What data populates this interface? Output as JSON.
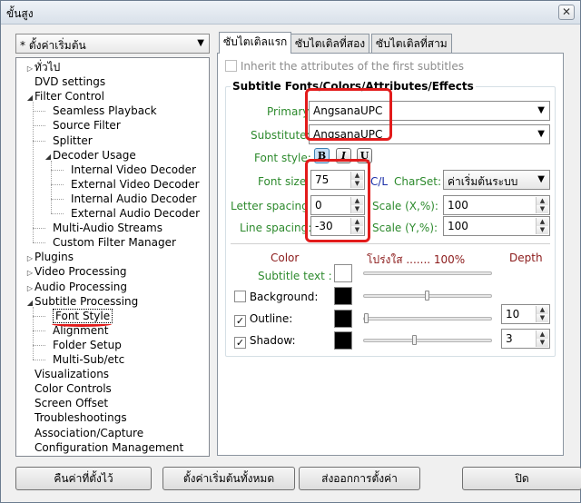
{
  "window": {
    "title": "ขั้นสูง",
    "close_glyph": "✕"
  },
  "profile": {
    "value": "* ตั้งค่าเริ่มต้น"
  },
  "tree": [
    {
      "label": "ทั่วไป",
      "level": 0,
      "exp": "▷"
    },
    {
      "label": "DVD settings",
      "level": 0,
      "exp": ""
    },
    {
      "label": "Filter Control",
      "level": 0,
      "exp": "◢"
    },
    {
      "label": "Seamless Playback",
      "level": 1,
      "exp": ""
    },
    {
      "label": "Source Filter",
      "level": 1,
      "exp": ""
    },
    {
      "label": "Splitter",
      "level": 1,
      "exp": ""
    },
    {
      "label": "Decoder Usage",
      "level": 1,
      "exp": "◢"
    },
    {
      "label": "Internal Video Decoder",
      "level": 2,
      "exp": ""
    },
    {
      "label": "External Video Decoder",
      "level": 2,
      "exp": ""
    },
    {
      "label": "Internal Audio Decoder",
      "level": 2,
      "exp": ""
    },
    {
      "label": "External Audio Decoder",
      "level": 2,
      "exp": ""
    },
    {
      "label": "Multi-Audio Streams",
      "level": 1,
      "exp": ""
    },
    {
      "label": "Custom Filter Manager",
      "level": 1,
      "exp": ""
    },
    {
      "label": "Plugins",
      "level": 0,
      "exp": "▷"
    },
    {
      "label": "Video Processing",
      "level": 0,
      "exp": "▷"
    },
    {
      "label": "Audio Processing",
      "level": 0,
      "exp": "▷"
    },
    {
      "label": "Subtitle Processing",
      "level": 0,
      "exp": "◢"
    },
    {
      "label": "Font Style",
      "level": 1,
      "exp": "",
      "selected": true
    },
    {
      "label": "Alignment",
      "level": 1,
      "exp": ""
    },
    {
      "label": "Folder Setup",
      "level": 1,
      "exp": ""
    },
    {
      "label": "Multi-Sub/etc",
      "level": 1,
      "exp": ""
    },
    {
      "label": "Visualizations",
      "level": 0,
      "exp": ""
    },
    {
      "label": "Color Controls",
      "level": 0,
      "exp": ""
    },
    {
      "label": "Screen Offset",
      "level": 0,
      "exp": ""
    },
    {
      "label": "Troubleshootings",
      "level": 0,
      "exp": ""
    },
    {
      "label": "Association/Capture",
      "level": 0,
      "exp": ""
    },
    {
      "label": "Configuration Management",
      "level": 0,
      "exp": ""
    }
  ],
  "tabs": [
    {
      "label": "ซับไตเติลแรก",
      "active": true
    },
    {
      "label": "ซับไตเติลที่สอง",
      "active": false
    },
    {
      "label": "ซับไตเติลที่สาม",
      "active": false
    }
  ],
  "panel": {
    "inherit_label": "Inherit the attributes of the first subtitles",
    "group_title": "Subtitle Fonts/Colors/Attributes/Effects",
    "primary_label": "Primary:",
    "primary_value": "AngsanaUPC",
    "substitute_label": "Substitute:",
    "substitute_value": "AngsanaUPC",
    "font_style_label": "Font style:",
    "bold": "B",
    "italic": "I",
    "underline": "U",
    "font_size_label": "Font size",
    "font_size_value": "75",
    "letter_spacing_label": "Letter spacing",
    "letter_spacing_value": "0",
    "line_spacing_label": "Line spacing:",
    "line_spacing_value": "-30",
    "cl_label": "C/L",
    "charset_label": "CharSet:",
    "charset_value": "ค่าเริ่มต้นระบบ",
    "scale_x_label": "Scale (X,%):",
    "scale_x_value": "100",
    "scale_y_label": "Scale (Y,%):",
    "scale_y_value": "100",
    "color_header": "Color",
    "opacity_header": "โปร่งใส ....... 100%",
    "depth_header": "Depth",
    "subtitle_text_label": "Subtitle text :",
    "background_label": "Background:",
    "outline_label": "Outline:",
    "outline_depth": "10",
    "shadow_label": "Shadow:",
    "shadow_depth": "3",
    "check_mark": "✓",
    "colors": {
      "subtitle_text": "#ffffff",
      "background": "#000000",
      "outline": "#000000",
      "shadow": "#000000"
    }
  },
  "buttons": {
    "reset": "คืนค่าที่ตั้งไว้",
    "default_all": "ตั้งค่าเริ่มต้นทั้งหมด",
    "export": "ส่งออกการตั้งค่า",
    "close": "ปิด"
  },
  "icons": {
    "dropdown": "▼",
    "spin_up": "▲",
    "spin_down": "▼"
  }
}
